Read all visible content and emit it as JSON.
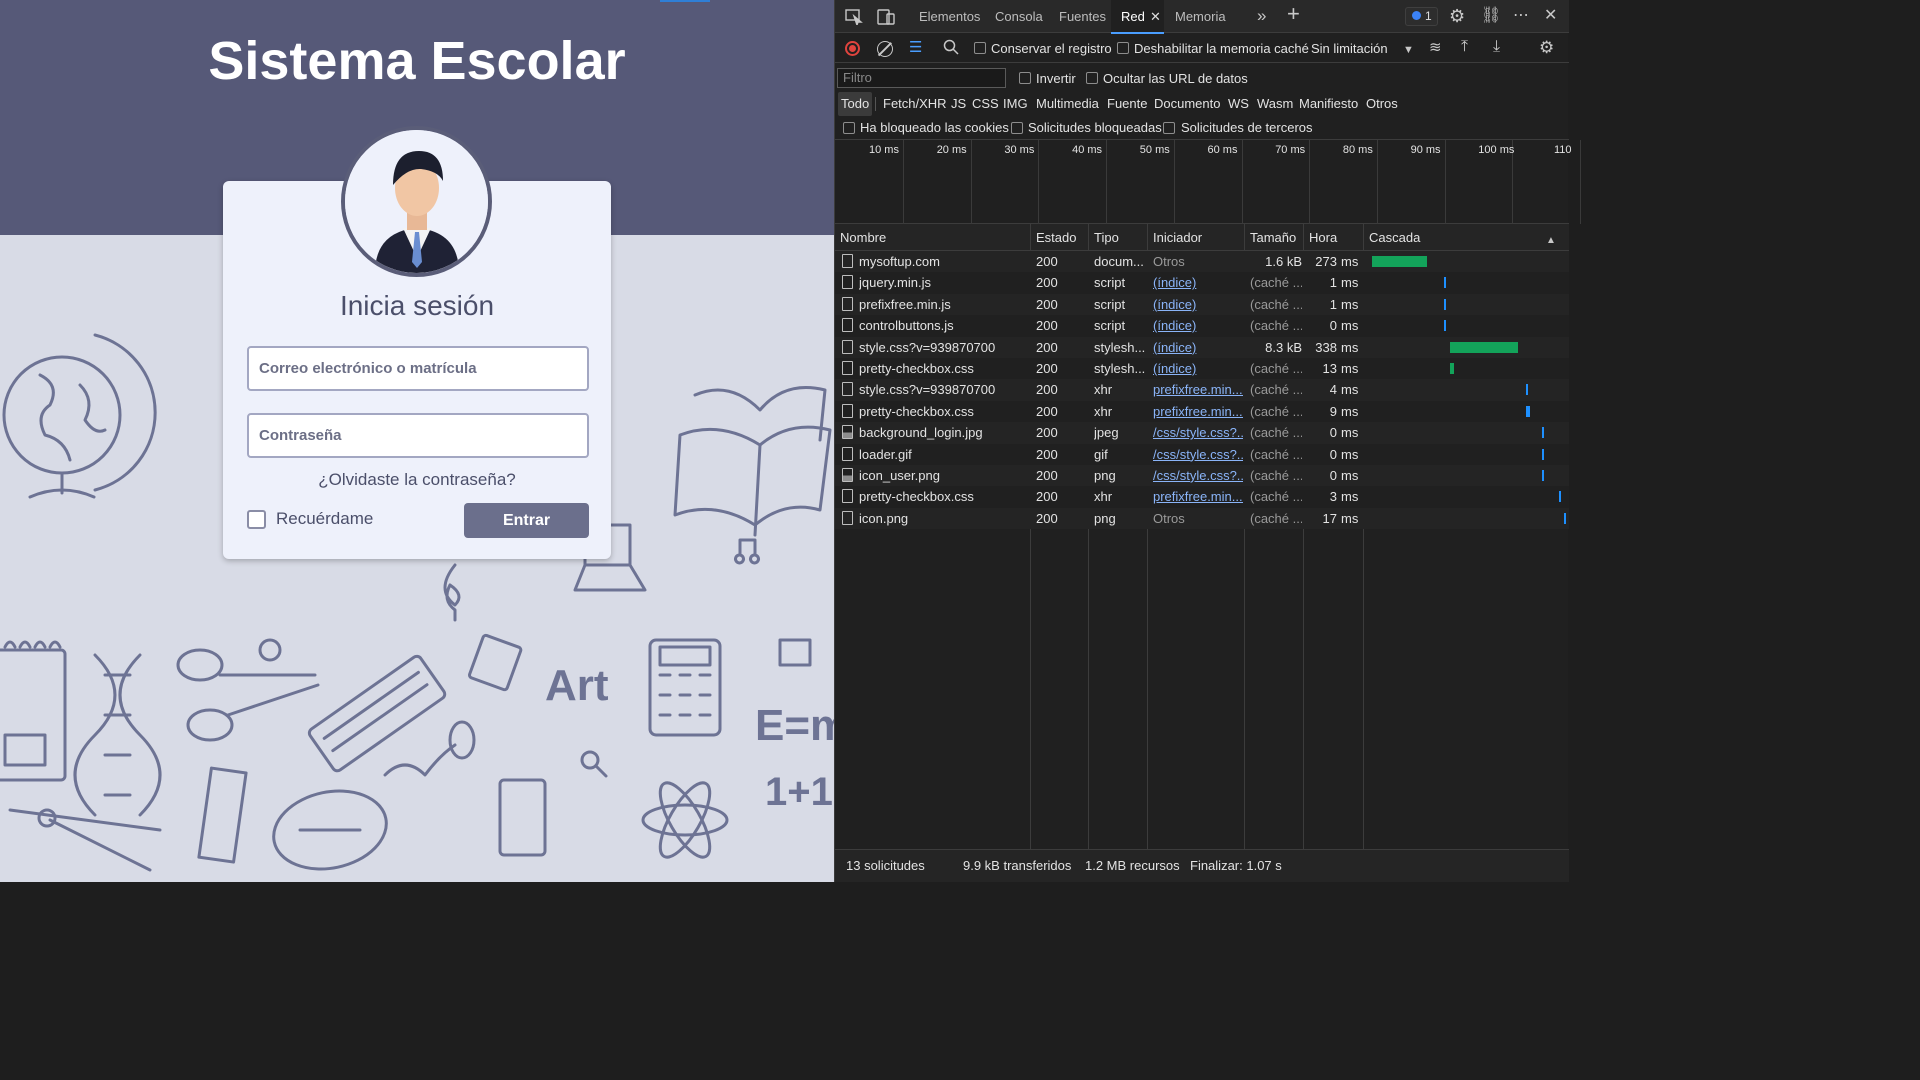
{
  "site": {
    "title": "Sistema Escolar",
    "login_title": "Inicia sesión",
    "email_placeholder": "Correo electrónico o matrícula",
    "password_placeholder": "Contraseña",
    "forgot_link": "¿Olvidaste la contraseña?",
    "remember_label": "Recuérdame",
    "submit_label": "Entrar",
    "doodle_text": {
      "art": "Art",
      "emc": "E=m",
      "oneplus": "1+1"
    }
  },
  "devtools": {
    "tabs": [
      "Elementos",
      "Consola",
      "Fuentes",
      "Red",
      "Memoria"
    ],
    "active_tab": "Red",
    "issues_count": "1",
    "toolbar": {
      "preserve_log": "Conservar el registro",
      "disable_cache": "Deshabilitar la memoria caché",
      "throttling": "Sin limitación"
    },
    "filter": {
      "placeholder": "Filtro",
      "invert": "Invertir",
      "hide_data_urls": "Ocultar las URL de datos"
    },
    "types": [
      "Todo",
      "Fetch/XHR",
      "JS",
      "CSS",
      "IMG",
      "Multimedia",
      "Fuente",
      "Documento",
      "WS",
      "Wasm",
      "Manifiesto",
      "Otros"
    ],
    "cookie_filters": [
      "Ha bloqueado las cookies",
      "Solicitudes bloqueadas",
      "Solicitudes de terceros"
    ],
    "timeline_ticks": [
      "10 ms",
      "20 ms",
      "30 ms",
      "40 ms",
      "50 ms",
      "60 ms",
      "70 ms",
      "80 ms",
      "90 ms",
      "100 ms",
      "110"
    ],
    "columns": [
      "Nombre",
      "Estado",
      "Tipo",
      "Iniciador",
      "Tamaño",
      "Hora",
      "Cascada"
    ],
    "requests": [
      {
        "name": "mysoftup.com",
        "status": "200",
        "type": "docum...",
        "initiator": "Otros",
        "initiator_link": false,
        "size": "1.6 kB",
        "time": "273",
        "unit": "ms",
        "icon": "doc-icon",
        "wf_start": 0.01,
        "wf_len": 0.28,
        "wf_color": "#13a35a"
      },
      {
        "name": "jquery.min.js",
        "status": "200",
        "type": "script",
        "initiator": "(índice)",
        "initiator_link": true,
        "size": "(caché ...",
        "time": "1",
        "unit": "ms",
        "icon": "doc-icon",
        "wf_start": 0.38,
        "wf_len": 0.01,
        "wf_color": "#1e90ff"
      },
      {
        "name": "prefixfree.min.js",
        "status": "200",
        "type": "script",
        "initiator": "(índice)",
        "initiator_link": true,
        "size": "(caché ...",
        "time": "1",
        "unit": "ms",
        "icon": "doc-icon",
        "wf_start": 0.38,
        "wf_len": 0.01,
        "wf_color": "#1e90ff"
      },
      {
        "name": "controlbuttons.js",
        "status": "200",
        "type": "script",
        "initiator": "(índice)",
        "initiator_link": true,
        "size": "(caché ...",
        "time": "0",
        "unit": "ms",
        "icon": "doc-icon",
        "wf_start": 0.38,
        "wf_len": 0.01,
        "wf_color": "#1e90ff"
      },
      {
        "name": "style.css?v=939870700",
        "status": "200",
        "type": "stylesh...",
        "initiator": "(índice)",
        "initiator_link": true,
        "size": "8.3 kB",
        "time": "338",
        "unit": "ms",
        "icon": "doc-icon",
        "wf_start": 0.41,
        "wf_len": 0.35,
        "wf_color": "#13a35a"
      },
      {
        "name": "pretty-checkbox.css",
        "status": "200",
        "type": "stylesh...",
        "initiator": "(índice)",
        "initiator_link": true,
        "size": "(caché ...",
        "time": "13",
        "unit": "ms",
        "icon": "doc-icon",
        "wf_start": 0.41,
        "wf_len": 0.02,
        "wf_color": "#13a35a"
      },
      {
        "name": "style.css?v=939870700",
        "status": "200",
        "type": "xhr",
        "initiator": "prefixfree.min....",
        "initiator_link": true,
        "size": "(caché ...",
        "time": "4",
        "unit": "ms",
        "icon": "doc-icon",
        "wf_start": 0.8,
        "wf_len": 0.01,
        "wf_color": "#1e90ff"
      },
      {
        "name": "pretty-checkbox.css",
        "status": "200",
        "type": "xhr",
        "initiator": "prefixfree.min....",
        "initiator_link": true,
        "size": "(caché ...",
        "time": "9",
        "unit": "ms",
        "icon": "doc-icon",
        "wf_start": 0.8,
        "wf_len": 0.02,
        "wf_color": "#1e90ff"
      },
      {
        "name": "background_login.jpg",
        "status": "200",
        "type": "jpeg",
        "initiator": "/css/style.css?...",
        "initiator_link": true,
        "size": "(caché ...",
        "time": "0",
        "unit": "ms",
        "icon": "image-icon",
        "wf_start": 0.88,
        "wf_len": 0.01,
        "wf_color": "#1e90ff"
      },
      {
        "name": "loader.gif",
        "status": "200",
        "type": "gif",
        "initiator": "/css/style.css?...",
        "initiator_link": true,
        "size": "(caché ...",
        "time": "0",
        "unit": "ms",
        "icon": "doc-icon",
        "wf_start": 0.88,
        "wf_len": 0.01,
        "wf_color": "#1e90ff"
      },
      {
        "name": "icon_user.png",
        "status": "200",
        "type": "png",
        "initiator": "/css/style.css?...",
        "initiator_link": true,
        "size": "(caché ...",
        "time": "0",
        "unit": "ms",
        "icon": "image-icon",
        "wf_start": 0.88,
        "wf_len": 0.01,
        "wf_color": "#1e90ff"
      },
      {
        "name": "pretty-checkbox.css",
        "status": "200",
        "type": "xhr",
        "initiator": "prefixfree.min....",
        "initiator_link": true,
        "size": "(caché ...",
        "time": "3",
        "unit": "ms",
        "icon": "doc-icon",
        "wf_start": 0.97,
        "wf_len": 0.01,
        "wf_color": "#1e90ff"
      },
      {
        "name": "icon.png",
        "status": "200",
        "type": "png",
        "initiator": "Otros",
        "initiator_link": false,
        "size": "(caché ...",
        "time": "17",
        "unit": "ms",
        "icon": "doc-icon",
        "wf_start": 0.995,
        "wf_len": 0.005,
        "wf_color": "#1e90ff"
      }
    ],
    "status": {
      "requests": "13 solicitudes",
      "transferred": "9.9 kB transferidos",
      "resources": "1.2 MB recursos",
      "finish": "Finalizar: 1.07 s"
    }
  }
}
